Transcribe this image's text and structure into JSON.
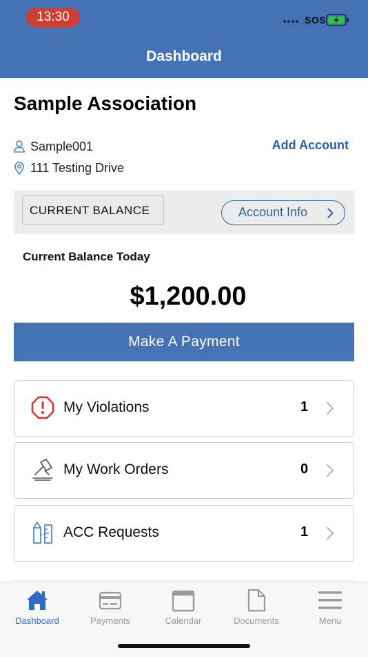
{
  "status_bar": {
    "time": "13:30",
    "carrier": "SOS"
  },
  "header": {
    "title": "Dashboard"
  },
  "association": {
    "name": "Sample Association",
    "account_id": "Sample001",
    "address": "111 Testing Drive",
    "add_account_label": "Add Account"
  },
  "balance": {
    "selector_label": "CURRENT BALANCE",
    "account_info_label": "Account Info",
    "today_label": "Current Balance Today",
    "amount": "$1,200.00",
    "pay_button_label": "Make A Payment"
  },
  "cards": [
    {
      "label": "My Violations",
      "count": "1",
      "icon": "alert-octagon-icon"
    },
    {
      "label": "My Work Orders",
      "count": "0",
      "icon": "work-order-hammer-icon"
    },
    {
      "label": "ACC Requests",
      "count": "1",
      "icon": "architecture-tools-icon"
    }
  ],
  "tabbar": {
    "items": [
      {
        "label": "Dashboard",
        "icon": "home-icon",
        "active": true
      },
      {
        "label": "Payments",
        "icon": "credit-card-icon",
        "active": false
      },
      {
        "label": "Calendar",
        "icon": "calendar-icon",
        "active": false
      },
      {
        "label": "Documents",
        "icon": "document-icon",
        "active": false
      },
      {
        "label": "Menu",
        "icon": "hamburger-menu-icon",
        "active": false
      }
    ]
  },
  "colors": {
    "header_bg": "#4472b5",
    "accent_link": "#2d5ea4",
    "violation_red": "#d9342b",
    "icon_blue": "#4a86d8",
    "tab_active": "#2f6ac6",
    "tab_inactive": "#9a9a9a",
    "time_pill": "#cf3d33",
    "battery_green": "#32c24a"
  }
}
